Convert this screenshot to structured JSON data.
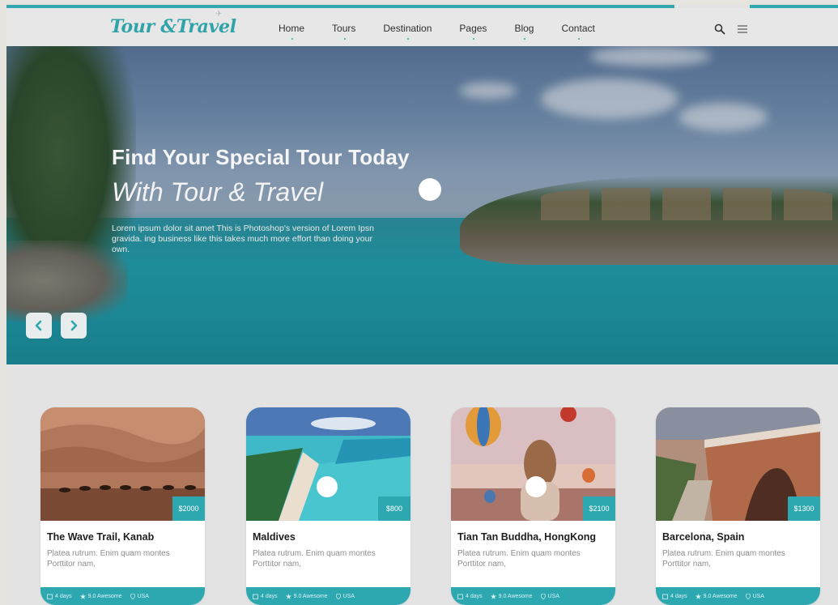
{
  "brand": {
    "logo": "Tour &Travel"
  },
  "nav": {
    "items": [
      "Home",
      "Tours",
      "Destination",
      "Pages",
      "Blog",
      "Contact"
    ]
  },
  "icons": {
    "search": "search-icon",
    "menu": "menu-icon",
    "prev": "chevron-left-icon",
    "next": "chevron-right-icon"
  },
  "hero": {
    "title": "Find Your Special Tour Today",
    "subtitle": "With Tour & Travel",
    "text": "Lorem ipsum dolor sit amet This is Photoshop's version of Lorem Ipsn gravida. ing business like this takes much more effort than doing your own."
  },
  "cards": [
    {
      "title": "The Wave Trail, Kanab",
      "price": "$2000",
      "desc": "Platea rutrum. Enim quam montes Porttitor nam,",
      "duration": "4 days",
      "rating": "9.0 Awesome",
      "location": "USA"
    },
    {
      "title": "Maldives",
      "price": "$800",
      "desc": "Platea rutrum. Enim quam montes Porttitor nam,",
      "duration": "4 days",
      "rating": "9.0 Awesome",
      "location": "USA"
    },
    {
      "title": "Tian Tan Buddha, HongKong",
      "price": "$2100",
      "desc": "Platea rutrum. Enim quam montes Porttitor nam,",
      "duration": "4 days",
      "rating": "9.0 Awesome",
      "location": "USA"
    },
    {
      "title": "Barcelona, Spain",
      "price": "$1300",
      "desc": "Platea rutrum. Enim quam montes Porttitor nam,",
      "duration": "4 days",
      "rating": "9.0 Awesome",
      "location": "USA"
    }
  ],
  "colors": {
    "accent": "#2ea8b0",
    "nav_text": "#2e2e2e",
    "background": "#e3e3e3"
  }
}
